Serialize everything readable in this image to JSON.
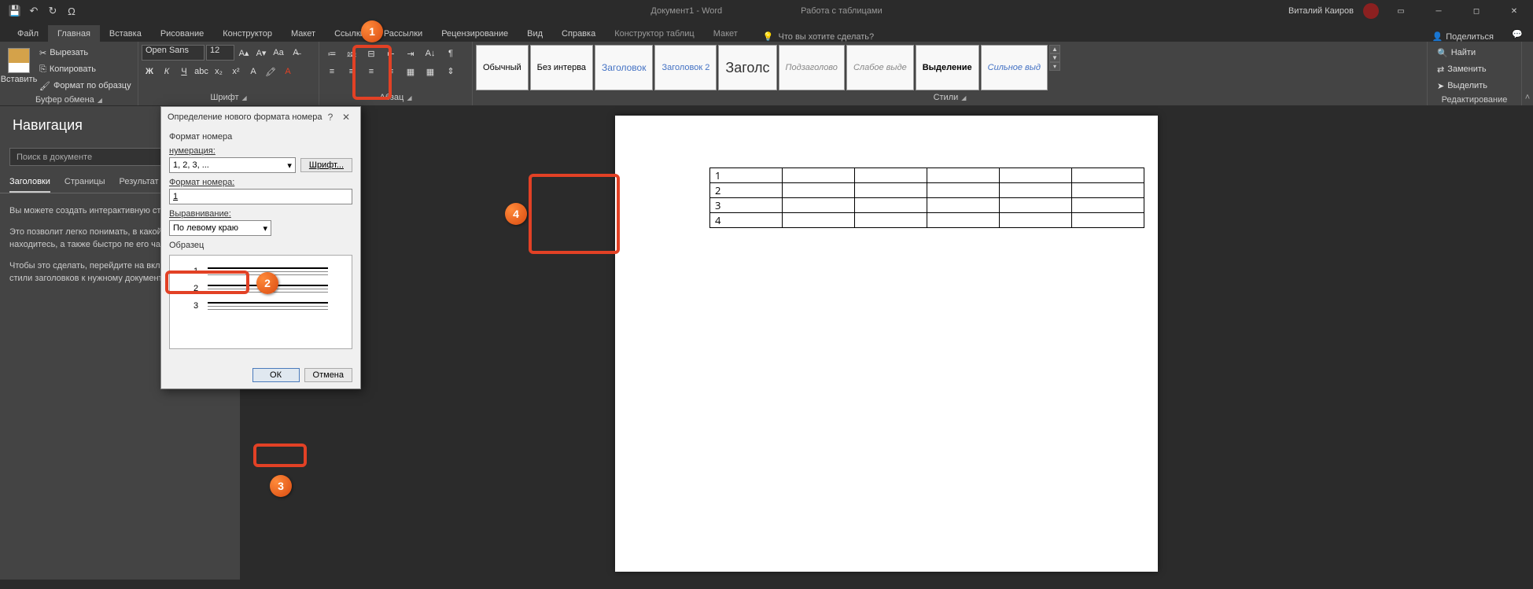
{
  "title": {
    "doc": "Документ1 - Word",
    "context": "Работа с таблицами",
    "user": "Виталий Каиров"
  },
  "tabs": {
    "file": "Файл",
    "home": "Главная",
    "insert": "Вставка",
    "draw": "Рисование",
    "design": "Конструктор",
    "layout": "Макет",
    "refs": "Ссылки",
    "mail": "Рассылки",
    "review": "Рецензирование",
    "view": "Вид",
    "help": "Справка",
    "tdesign": "Конструктор таблиц",
    "tlayout": "Макет",
    "tellme": "Что вы хотите сделать?",
    "share": "Поделиться"
  },
  "ribbon": {
    "clipboard": {
      "paste": "Вставить",
      "cut": "Вырезать",
      "copy": "Копировать",
      "format": "Формат по образцу",
      "label": "Буфер обмена"
    },
    "font": {
      "name": "Open Sans",
      "size": "12",
      "label": "Шрифт"
    },
    "paragraph": {
      "label": "Абзац"
    },
    "styles": {
      "label": "Стили",
      "items": [
        "Обычный",
        "Без интерва",
        "Заголовок",
        "Заголовок 2",
        "Заголс",
        "Подзаголово",
        "Слабое выде",
        "Выделение",
        "Сильное выд"
      ]
    },
    "editing": {
      "find": "Найти",
      "replace": "Заменить",
      "select": "Выделить",
      "label": "Редактирование"
    }
  },
  "nav": {
    "title": "Навигация",
    "search": "Поиск в документе",
    "tabs": {
      "headings": "Заголовки",
      "pages": "Страницы",
      "results": "Результат"
    },
    "p1": "Вы можете создать интерактивную стру",
    "p2": "Это позволит легко понимать, в какой ч вы сейчас находитесь, а также быстро пе его части.",
    "p3": "Чтобы это сделать, перейдите на вкладк примените стили заголовков к нужному документе."
  },
  "dialog": {
    "title": "Определение нового формата номера",
    "section": "Формат номера",
    "numbering_l": "нумерация:",
    "numbering_v": "1, 2, 3, ...",
    "font_btn": "Шрифт...",
    "format_l": "Формат номера:",
    "format_v": "1",
    "align_l": "Выравнивание:",
    "align_v": "По левому краю",
    "sample_l": "Образец",
    "ok": "ОК",
    "cancel": "Отмена"
  },
  "table": {
    "rows": [
      "1",
      "2",
      "3",
      "4"
    ]
  },
  "callouts": {
    "c1": "1",
    "c2": "2",
    "c3": "3",
    "c4": "4"
  }
}
